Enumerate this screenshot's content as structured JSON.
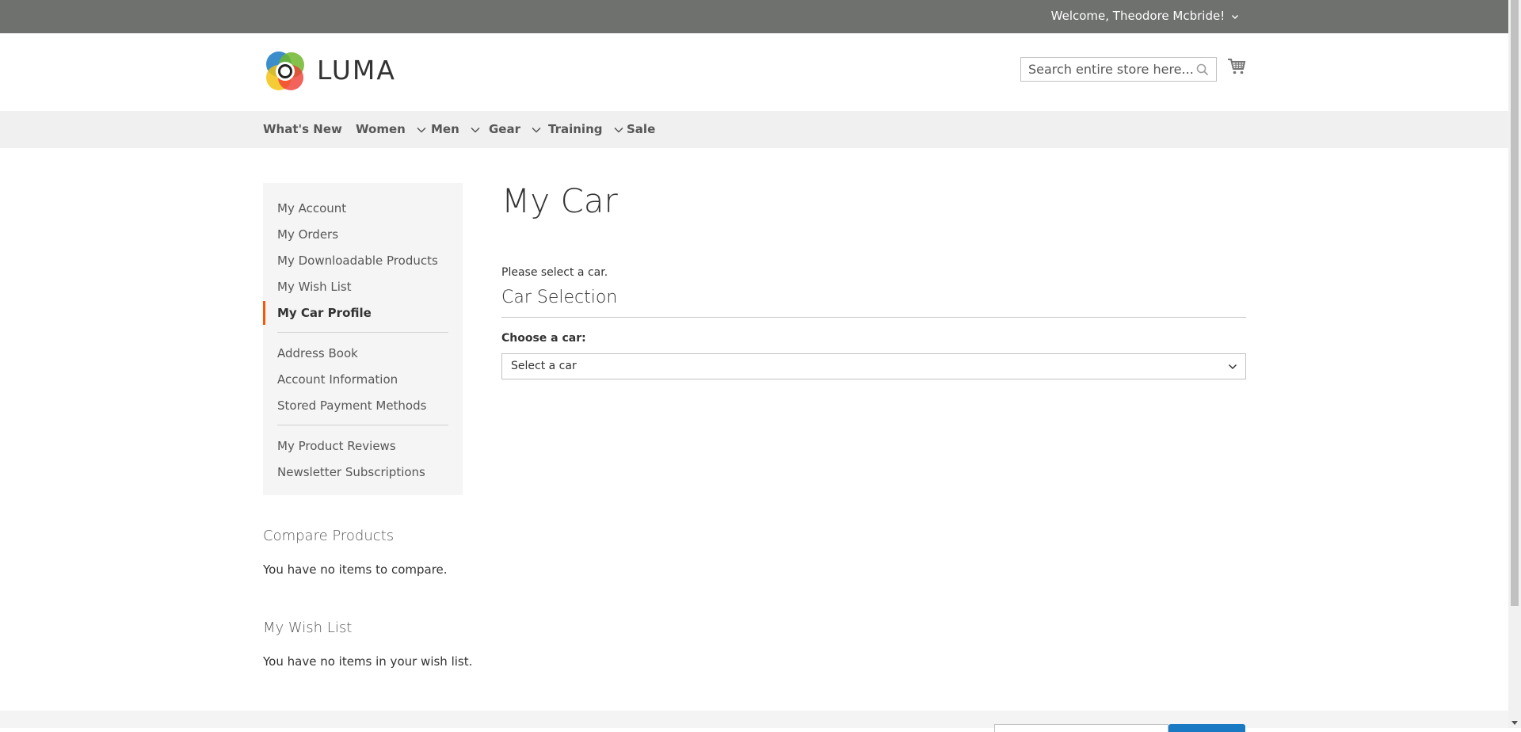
{
  "colors": {
    "topbar": "#6e716e",
    "nav_bg": "#f0f0f0",
    "sidebar_bg": "#f5f5f5",
    "active_accent": "#ff5501",
    "footer_button": "#1979c3"
  },
  "panel": {
    "welcome_text": "Welcome, Theodore Mcbride!"
  },
  "header": {
    "logo_text": "LUMA",
    "search_placeholder": "Search entire store here...",
    "icons": [
      "search-icon",
      "cart-icon",
      "chevron-down-icon"
    ]
  },
  "nav": {
    "items": [
      {
        "label": "What's New",
        "has_dropdown": false
      },
      {
        "label": "Women",
        "has_dropdown": true
      },
      {
        "label": "Men",
        "has_dropdown": true
      },
      {
        "label": "Gear",
        "has_dropdown": true
      },
      {
        "label": "Training",
        "has_dropdown": true
      },
      {
        "label": "Sale",
        "has_dropdown": false
      }
    ]
  },
  "sidebar": {
    "items": [
      {
        "label": "My Account"
      },
      {
        "label": "My Orders"
      },
      {
        "label": "My Downloadable Products"
      },
      {
        "label": "My Wish List"
      },
      {
        "label": "My Car Profile",
        "active": true
      },
      {
        "label": "Address Book"
      },
      {
        "label": "Account Information"
      },
      {
        "label": "Stored Payment Methods"
      },
      {
        "label": "My Product Reviews"
      },
      {
        "label": "Newsletter Subscriptions"
      }
    ],
    "compare": {
      "title": "Compare Products",
      "empty_text": "You have no items to compare."
    },
    "wishlist": {
      "title": "My Wish List",
      "empty_text": "You have no items in your wish list."
    }
  },
  "main": {
    "title": "My Car",
    "notice": "Please select a car.",
    "fieldset_legend": "Car Selection",
    "field_label": "Choose a car:",
    "select_value": "Select a car"
  }
}
